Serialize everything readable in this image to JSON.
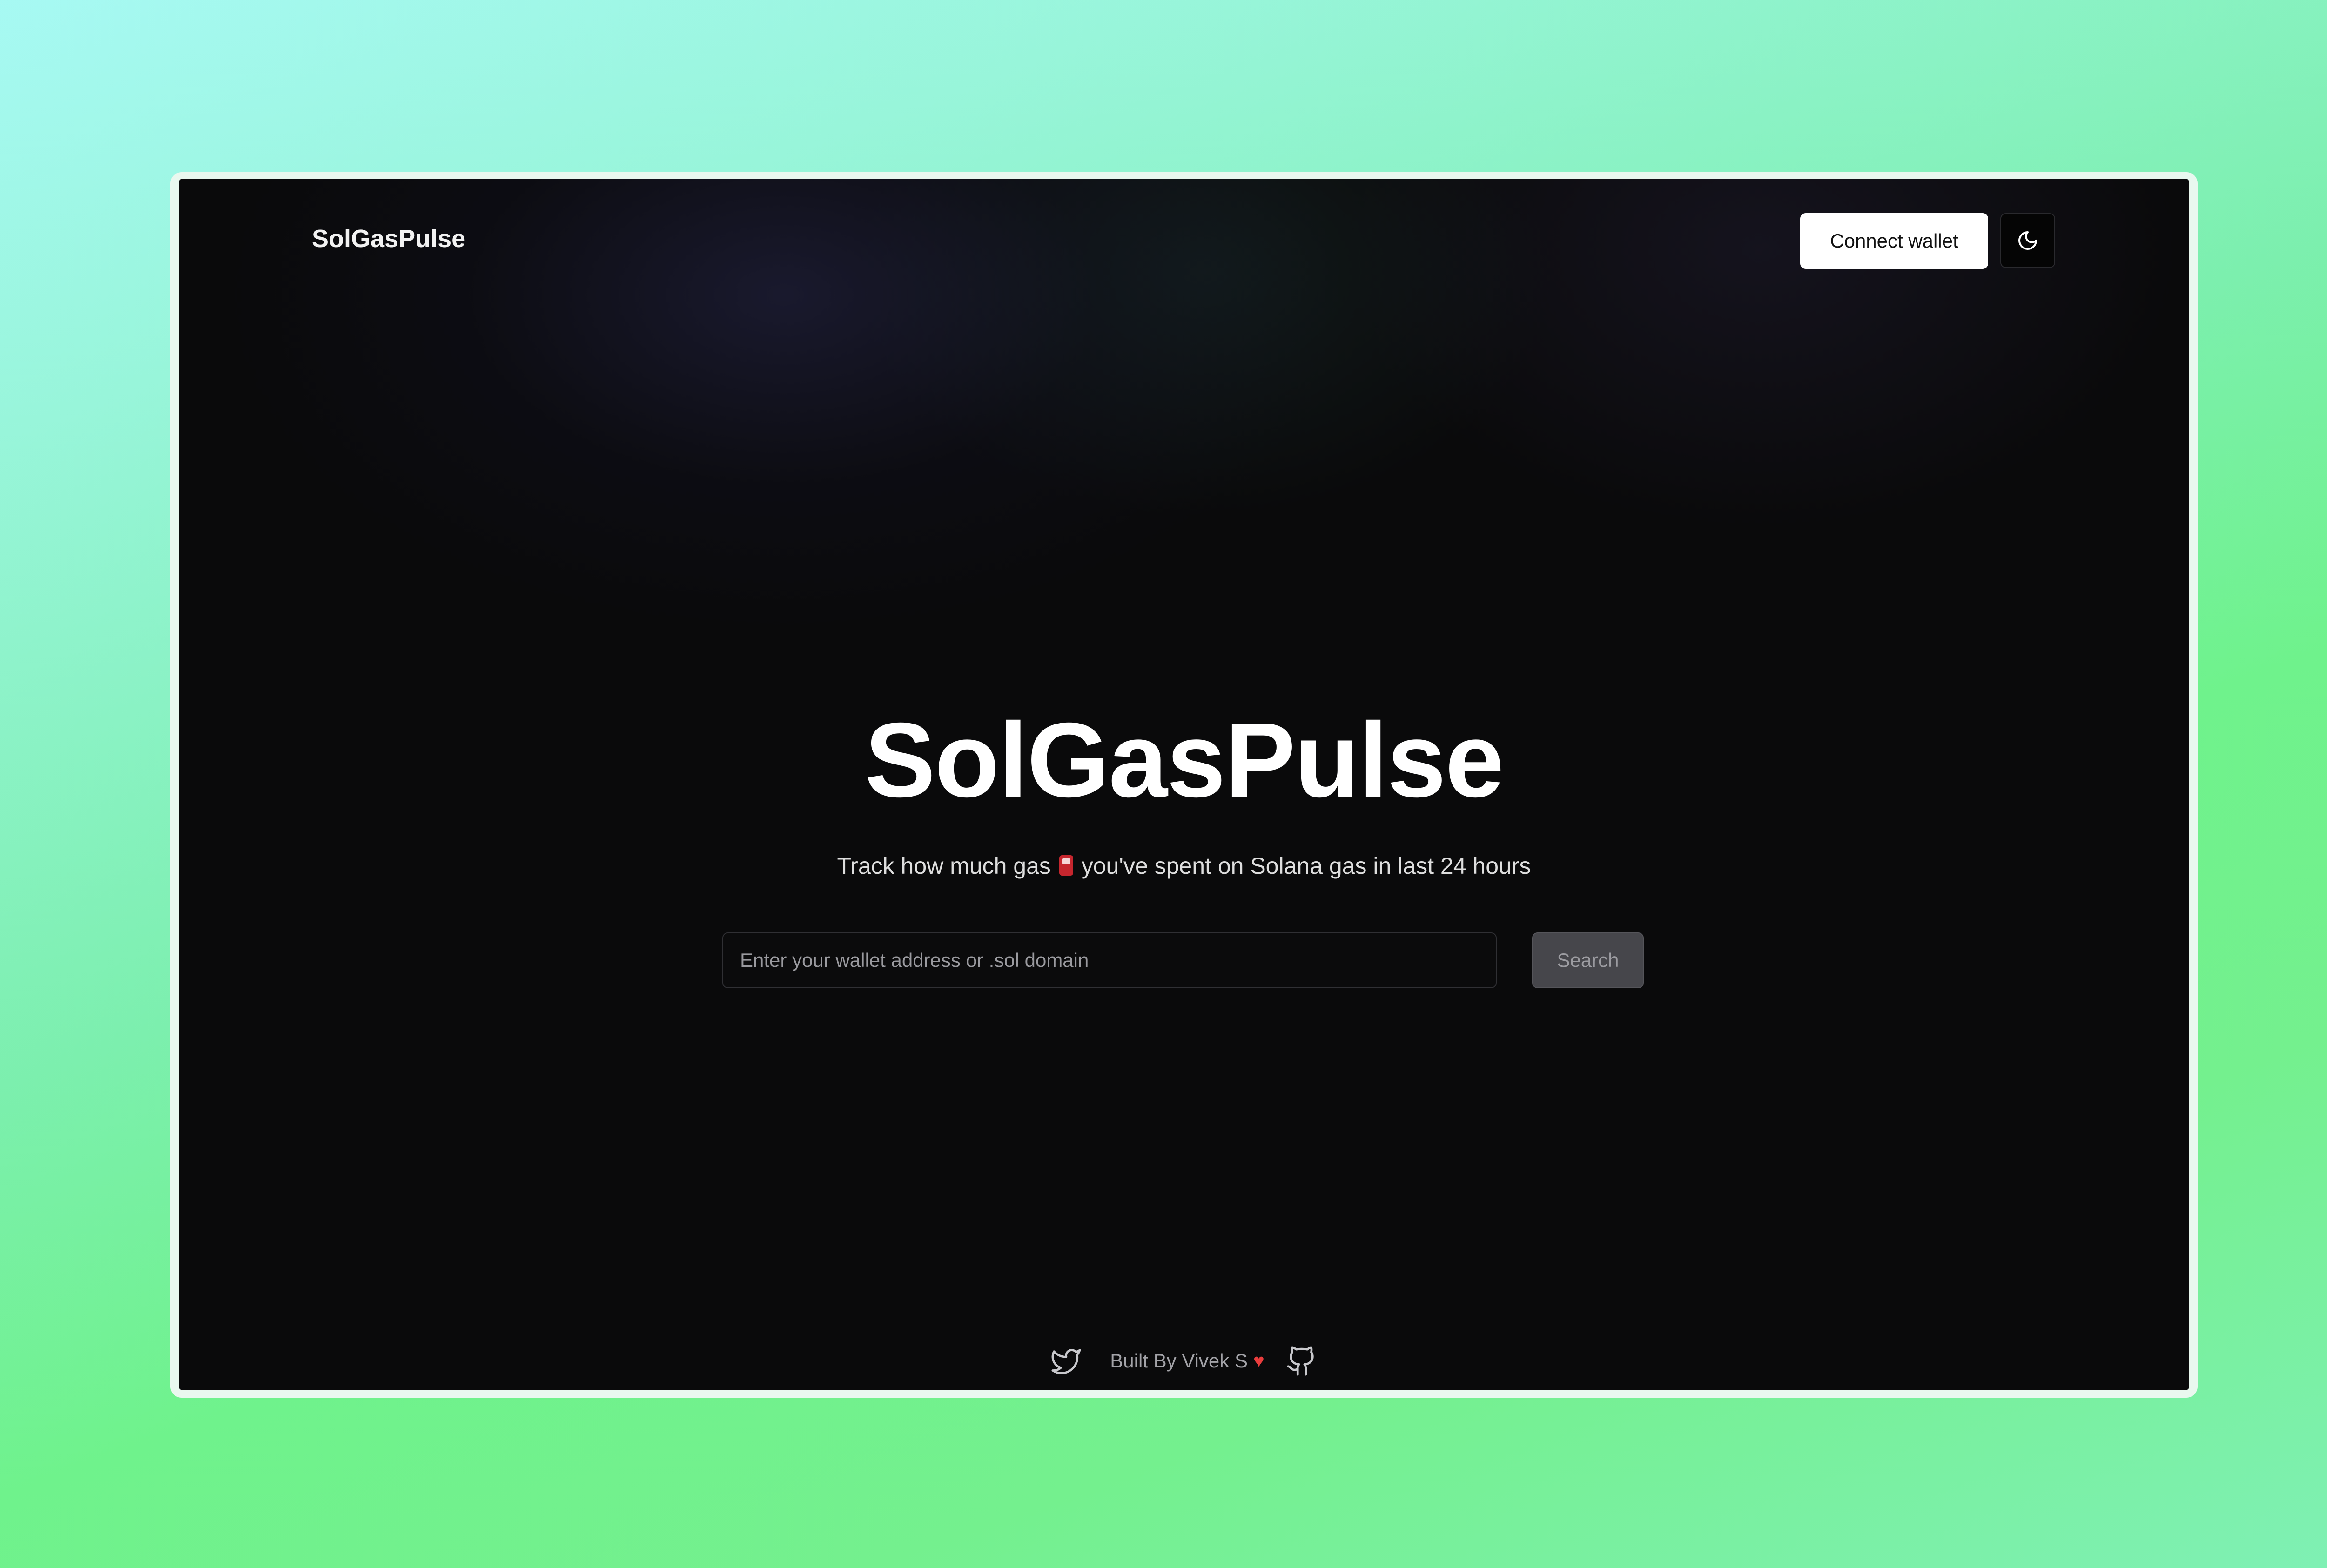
{
  "nav": {
    "brand": "SolGasPulse",
    "connect_wallet_label": "Connect wallet",
    "theme_toggle_icon": "moon-icon"
  },
  "hero": {
    "title": "SolGasPulse",
    "subtitle_before": "Track how much gas",
    "subtitle_icon": "fuel-pump-icon",
    "subtitle_after": "you've spent on Solana gas in last 24 hours"
  },
  "search": {
    "placeholder": "Enter your wallet address or .sol domain",
    "value": "",
    "button_label": "Search"
  },
  "footer": {
    "text": "Built By Vivek S",
    "heart": "♥",
    "twitter_icon": "twitter-icon",
    "github_icon": "github-icon"
  },
  "colors": {
    "background_gradient_start": "#a7f9f3",
    "background_gradient_end": "#6ff28c",
    "app_background": "#0a0a0b",
    "search_button_bg": "#46464b",
    "heart": "#ea3d3d"
  }
}
